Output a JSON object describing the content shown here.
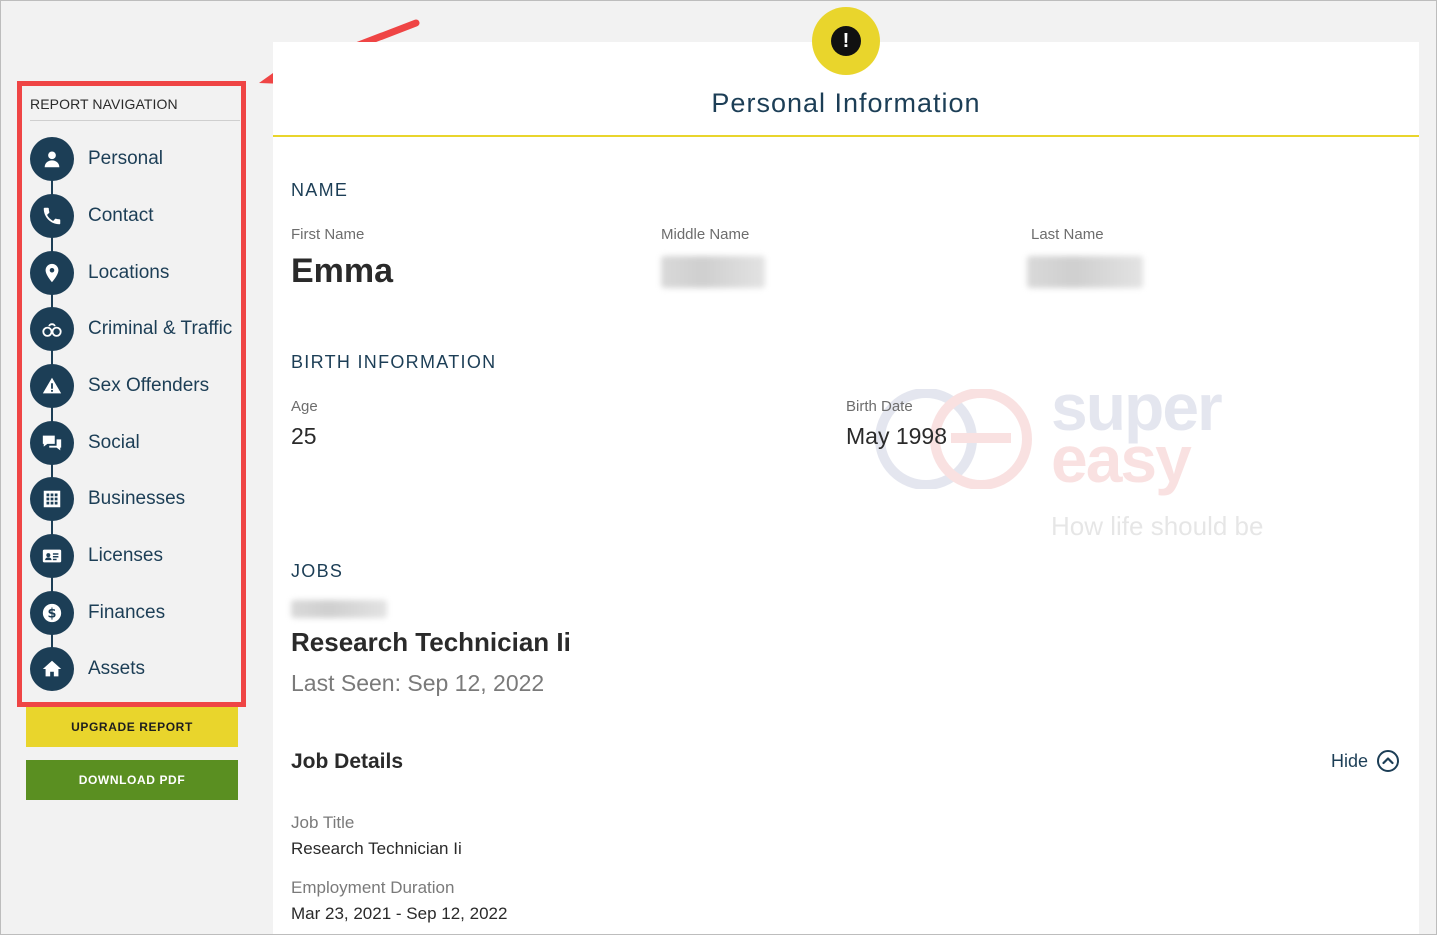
{
  "sidebar": {
    "title": "REPORT NAVIGATION",
    "items": [
      {
        "label": "Personal",
        "icon": "person-icon"
      },
      {
        "label": "Contact",
        "icon": "phone-icon"
      },
      {
        "label": "Locations",
        "icon": "map-pin-icon"
      },
      {
        "label": "Criminal & Traffic",
        "icon": "handcuffs-icon"
      },
      {
        "label": "Sex Offenders",
        "icon": "warning-icon"
      },
      {
        "label": "Social",
        "icon": "chat-bubbles-icon"
      },
      {
        "label": "Businesses",
        "icon": "building-icon"
      },
      {
        "label": "Licenses",
        "icon": "id-card-icon"
      },
      {
        "label": "Finances",
        "icon": "dollar-icon"
      },
      {
        "label": "Assets",
        "icon": "home-icon"
      }
    ],
    "upgrade_label": "UPGRADE REPORT",
    "download_label": "DOWNLOAD PDF"
  },
  "main": {
    "alert_symbol": "!",
    "title": "Personal Information",
    "name_section": {
      "heading": "NAME",
      "first_name_label": "First Name",
      "first_name_value": "Emma",
      "middle_name_label": "Middle Name",
      "last_name_label": "Last Name"
    },
    "birth_section": {
      "heading": "BIRTH INFORMATION",
      "age_label": "Age",
      "age_value": "25",
      "birth_date_label": "Birth Date",
      "birth_date_value": "May 1998"
    },
    "jobs_section": {
      "heading": "JOBS",
      "job_title": "Research Technician Ii",
      "last_seen": "Last Seen: Sep 12, 2022",
      "details_heading": "Job Details",
      "hide_label": "Hide",
      "job_title_label": "Job Title",
      "job_title_value": "Research Technician Ii",
      "duration_label": "Employment Duration",
      "duration_value": "Mar 23, 2021 - Sep 12, 2022"
    }
  },
  "watermark": {
    "line1": "super",
    "line2": "easy",
    "tagline": "How life should be"
  },
  "colors": {
    "navy": "#1c3e56",
    "yellow": "#e9d52c",
    "green": "#5a8f21",
    "highlight_red": "#ef4545"
  }
}
